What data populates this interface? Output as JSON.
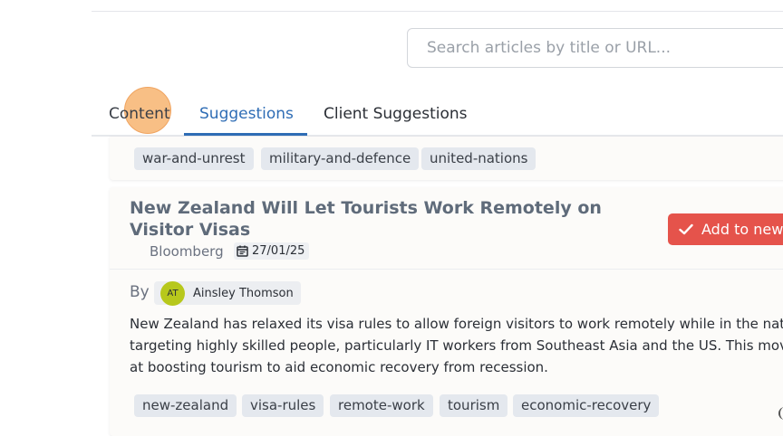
{
  "search": {
    "placeholder": "Search articles by title or URL..."
  },
  "tabs": [
    {
      "label": "Content"
    },
    {
      "label": "Suggestions",
      "active": true
    },
    {
      "label": "Client Suggestions"
    }
  ],
  "previous_card": {
    "tags": [
      "war-and-unrest",
      "military-and-defence",
      "united-nations"
    ]
  },
  "article": {
    "title": "New Zealand Will Let Tourists Work Remotely on Visitor Visas",
    "source": "Bloomberg",
    "date": "27/01/25",
    "add_button_label": "Add to news",
    "by_label": "By",
    "author": {
      "initials": "AT",
      "name": "Ainsley Thomson"
    },
    "description_lines": [
      "New Zealand has relaxed its visa rules to allow foreign visitors to work remotely while in the nation,",
      "targeting highly skilled people, particularly IT workers from Southeast Asia and the US. This move is a",
      "at boosting tourism to aid economic recovery from recession."
    ],
    "tags": [
      "new-zealand",
      "visa-rules",
      "remote-work",
      "tourism",
      "economic-recovery"
    ]
  },
  "colors": {
    "accent": "#2f6db5",
    "add_button": "#e5534b",
    "orange_button": "#f39c1f",
    "blue_button": "#2f76c8",
    "avatar": "#b7c81c",
    "highlight": "#f6aa5c"
  }
}
